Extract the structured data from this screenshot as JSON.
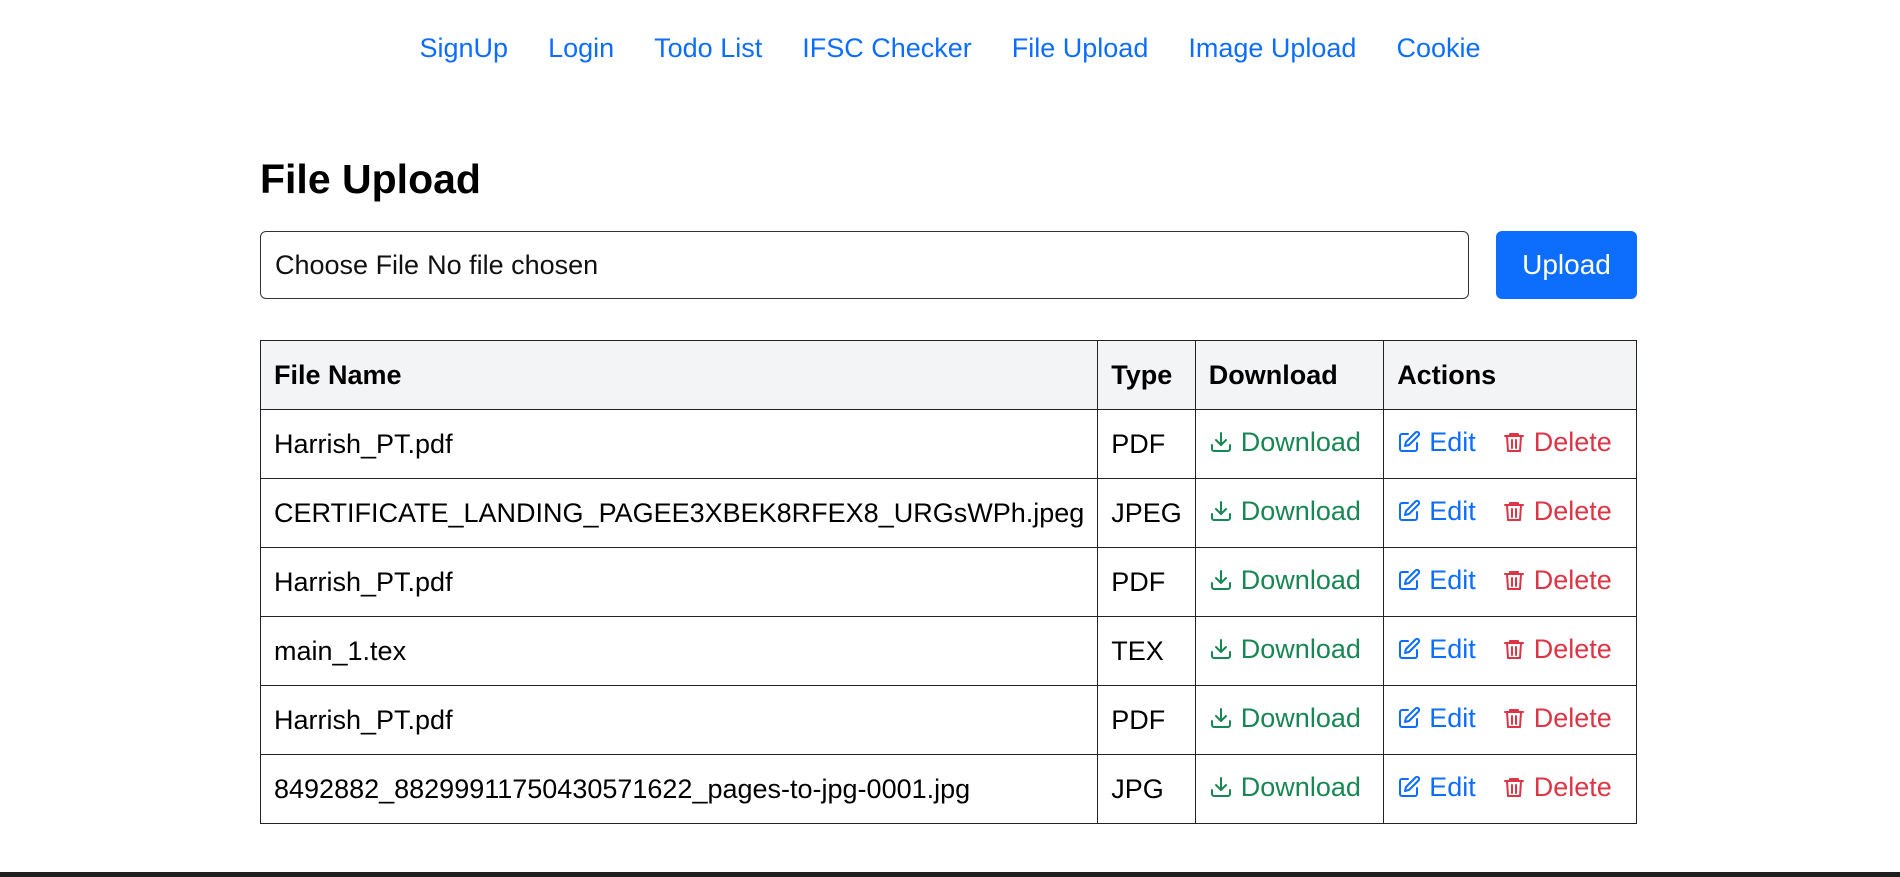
{
  "nav": {
    "links": [
      "SignUp",
      "Login",
      "Todo List",
      "IFSC Checker",
      "File Upload",
      "Image Upload",
      "Cookie"
    ]
  },
  "page_title": "File Upload",
  "upload": {
    "choose_label": "Choose File",
    "status": "No file chosen",
    "button_label": "Upload"
  },
  "table": {
    "headers": [
      "File Name",
      "Type",
      "Download",
      "Actions"
    ],
    "rows": [
      {
        "name": "Harrish_PT.pdf",
        "type": "PDF"
      },
      {
        "name": "CERTIFICATE_LANDING_PAGEE3XBEK8RFEX8_URGsWPh.jpeg",
        "type": "JPEG"
      },
      {
        "name": "Harrish_PT.pdf",
        "type": "PDF"
      },
      {
        "name": "main_1.tex",
        "type": "TEX"
      },
      {
        "name": "Harrish_PT.pdf",
        "type": "PDF"
      },
      {
        "name": "8492882_88299911750430571622_pages-to-jpg-0001.jpg",
        "type": "JPG"
      }
    ],
    "download_label": "Download",
    "edit_label": "Edit",
    "delete_label": "Delete"
  },
  "colors": {
    "link": "#0d6efd",
    "download": "#198754",
    "delete": "#dc3545",
    "header_bg": "#f3f4f6"
  },
  "icons": {
    "download": "download-icon",
    "edit": "edit-icon",
    "delete": "trash-icon"
  }
}
